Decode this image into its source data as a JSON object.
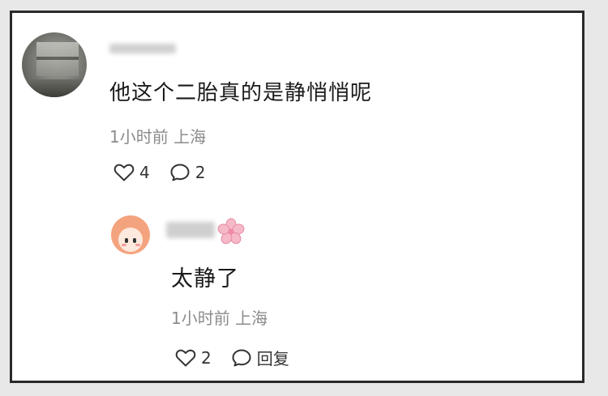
{
  "comment": {
    "text": "他这个二胎真的是静悄悄呢",
    "time": "1小时前",
    "location": "上海",
    "like_count": "4",
    "reply_count": "2"
  },
  "reply": {
    "text": "太静了",
    "time": "1小时前",
    "location": "上海",
    "like_count": "2",
    "reply_label": "回复"
  },
  "icons": {
    "like": "heart-icon",
    "comment": "comment-bubble-icon",
    "badge": "sakura-flower-icon"
  },
  "colors": {
    "text": "#1a1a1a",
    "meta": "#8c8c8c",
    "avatar_reply": "#f4a37f",
    "sakura": "#f6b9c8"
  }
}
